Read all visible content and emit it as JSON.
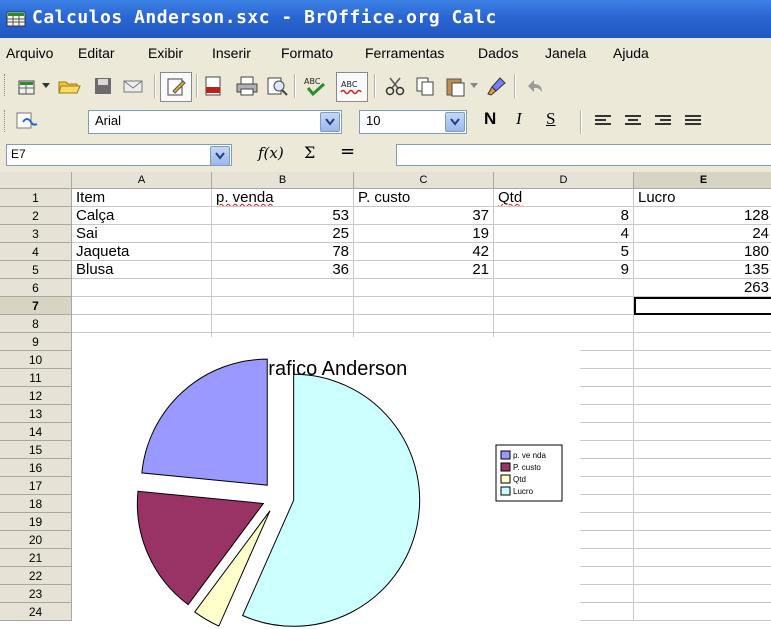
{
  "window": {
    "title": "Calculos Anderson.sxc - BrOffice.org Calc"
  },
  "menu": [
    "Arquivo",
    "Editar",
    "Exibir",
    "Inserir",
    "Formato",
    "Ferramentas",
    "Dados",
    "Janela",
    "Ajuda"
  ],
  "toolbar": {
    "font_name": "Arial",
    "font_size": "10",
    "bold": "N",
    "italic": "I",
    "underline": "S"
  },
  "formula_bar": {
    "cell_ref": "E7",
    "fx": "f(x)",
    "sum": "Σ",
    "equals": "=",
    "content": ""
  },
  "columns": [
    "A",
    "B",
    "C",
    "D",
    "E"
  ],
  "rows": [
    "1",
    "2",
    "3",
    "4",
    "5",
    "6",
    "7",
    "8",
    "9",
    "10",
    "11",
    "12",
    "13",
    "14",
    "15",
    "16",
    "17",
    "18",
    "19",
    "20",
    "21",
    "22",
    "23",
    "24"
  ],
  "sheet": {
    "header": [
      "Item",
      "p. venda",
      "P. custo",
      "Qtd",
      "Lucro"
    ],
    "data": [
      [
        "Calça",
        "53",
        "37",
        "8",
        "128"
      ],
      [
        "Sai",
        "25",
        "19",
        "4",
        "24"
      ],
      [
        "Jaqueta",
        "78",
        "42",
        "5",
        "180"
      ],
      [
        "Blusa",
        "36",
        "21",
        "9",
        "135"
      ]
    ],
    "total": "263",
    "active_cell": "E7"
  },
  "chart_data": {
    "type": "pie",
    "title": "Grafico Anderson",
    "labels": [
      "p. ve nda",
      "P. custo",
      "Qtd",
      "Lucro"
    ],
    "values": [
      53,
      37,
      8,
      128
    ],
    "colors": [
      "#9999ff",
      "#993366",
      "#ffffcc",
      "#ccffff"
    ],
    "legend": "right"
  }
}
